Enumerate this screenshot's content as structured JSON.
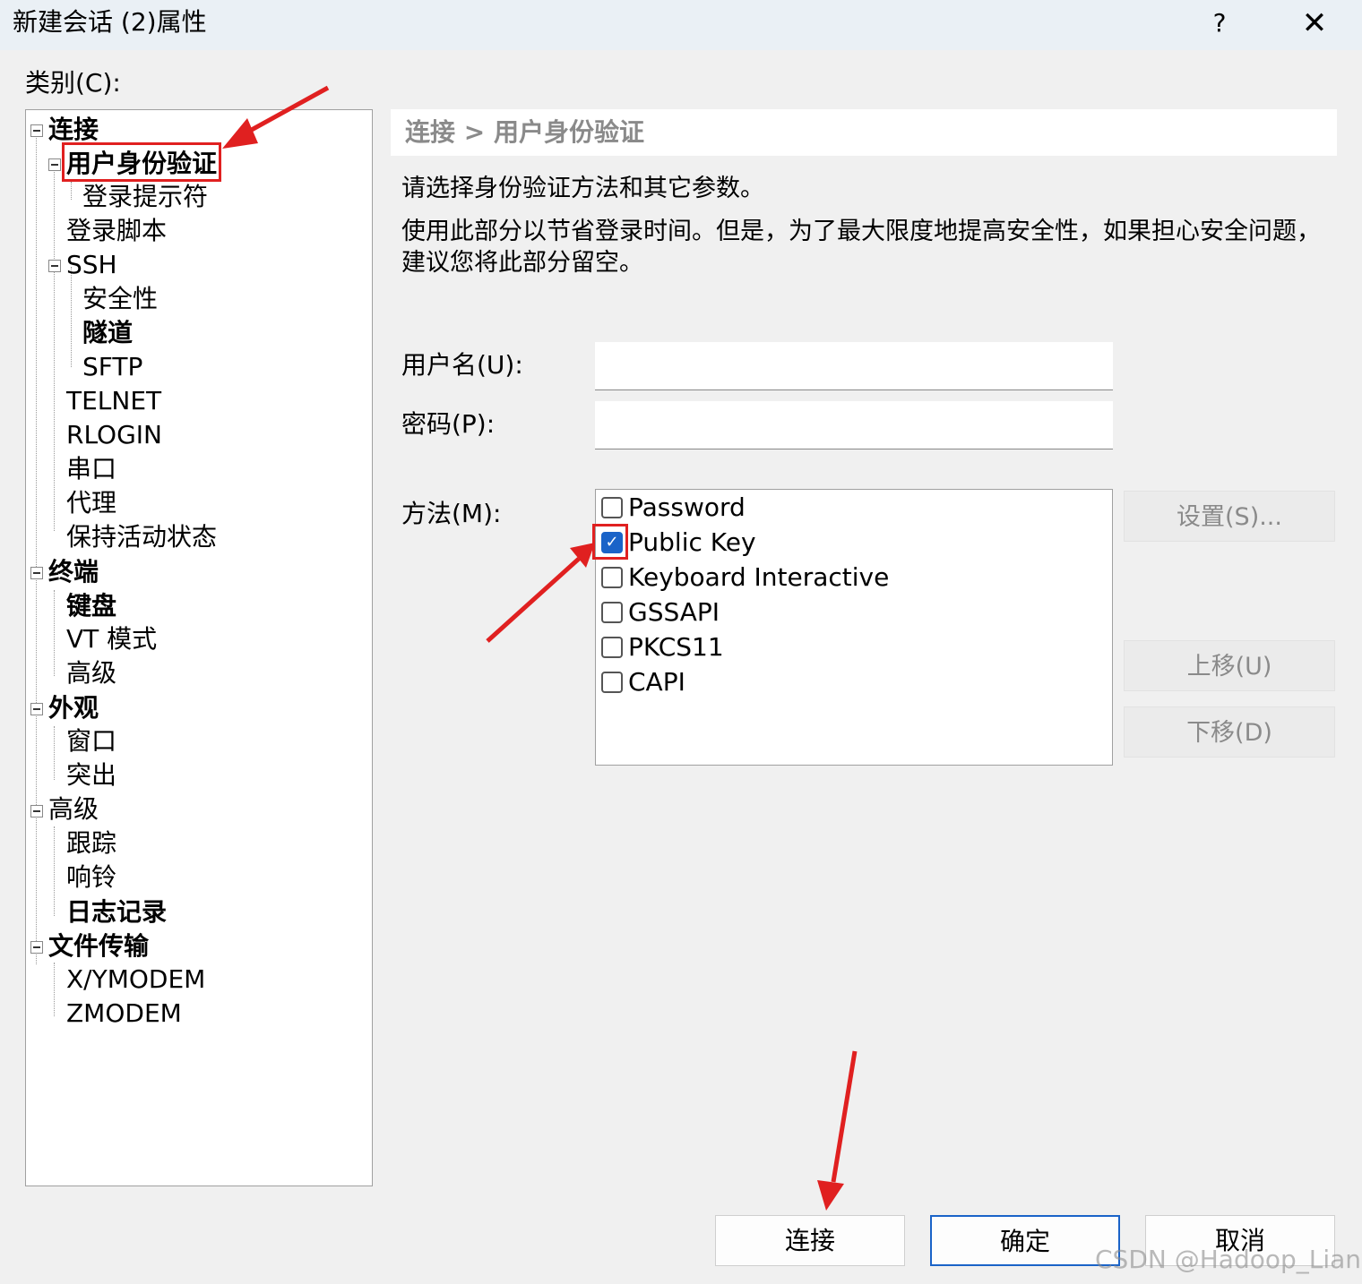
{
  "window": {
    "title": "新建会话 (2)属性",
    "help_label": "?",
    "close_label": "✕"
  },
  "category_label": "类别(C):",
  "tree": {
    "items": [
      {
        "label": "连接"
      },
      {
        "label": "用户身份验证"
      },
      {
        "label": "登录提示符"
      },
      {
        "label": "登录脚本"
      },
      {
        "label": "SSH"
      },
      {
        "label": "安全性"
      },
      {
        "label": "隧道"
      },
      {
        "label": "SFTP"
      },
      {
        "label": "TELNET"
      },
      {
        "label": "RLOGIN"
      },
      {
        "label": "串口"
      },
      {
        "label": "代理"
      },
      {
        "label": "保持活动状态"
      },
      {
        "label": "终端"
      },
      {
        "label": "键盘"
      },
      {
        "label": "VT 模式"
      },
      {
        "label": "高级"
      },
      {
        "label": "外观"
      },
      {
        "label": "窗口"
      },
      {
        "label": "突出"
      },
      {
        "label": "高级"
      },
      {
        "label": "跟踪"
      },
      {
        "label": "响铃"
      },
      {
        "label": "日志记录"
      },
      {
        "label": "文件传输"
      },
      {
        "label": "X/YMODEM"
      },
      {
        "label": "ZMODEM"
      }
    ]
  },
  "panel": {
    "breadcrumb": "连接 > 用户身份验证",
    "description_1": "请选择身份验证方法和其它参数。",
    "description_2": "使用此部分以节省登录时间。但是，为了最大限度地提高安全性，如果担心安全问题，",
    "description_3": "建议您将此部分留空。",
    "username_label": "用户名(U):",
    "username_value": "",
    "password_label": "密码(P):",
    "password_value": "",
    "method_label": "方法(M):",
    "methods": [
      {
        "label": "Password",
        "checked": false
      },
      {
        "label": "Public Key",
        "checked": true
      },
      {
        "label": "Keyboard Interactive",
        "checked": false
      },
      {
        "label": "GSSAPI",
        "checked": false
      },
      {
        "label": "PKCS11",
        "checked": false
      },
      {
        "label": "CAPI",
        "checked": false
      }
    ],
    "settings_button": "设置(S)...",
    "move_up_button": "上移(U)",
    "move_down_button": "下移(D)"
  },
  "footer": {
    "connect_button": "连接",
    "ok_button": "确定",
    "cancel_button": "取消"
  },
  "watermark": "CSDN @Hadoop_Liang",
  "colors": {
    "annotation_red": "#e02020",
    "checkbox_blue": "#1a63c8",
    "disabled_text": "#8a8a8a"
  }
}
